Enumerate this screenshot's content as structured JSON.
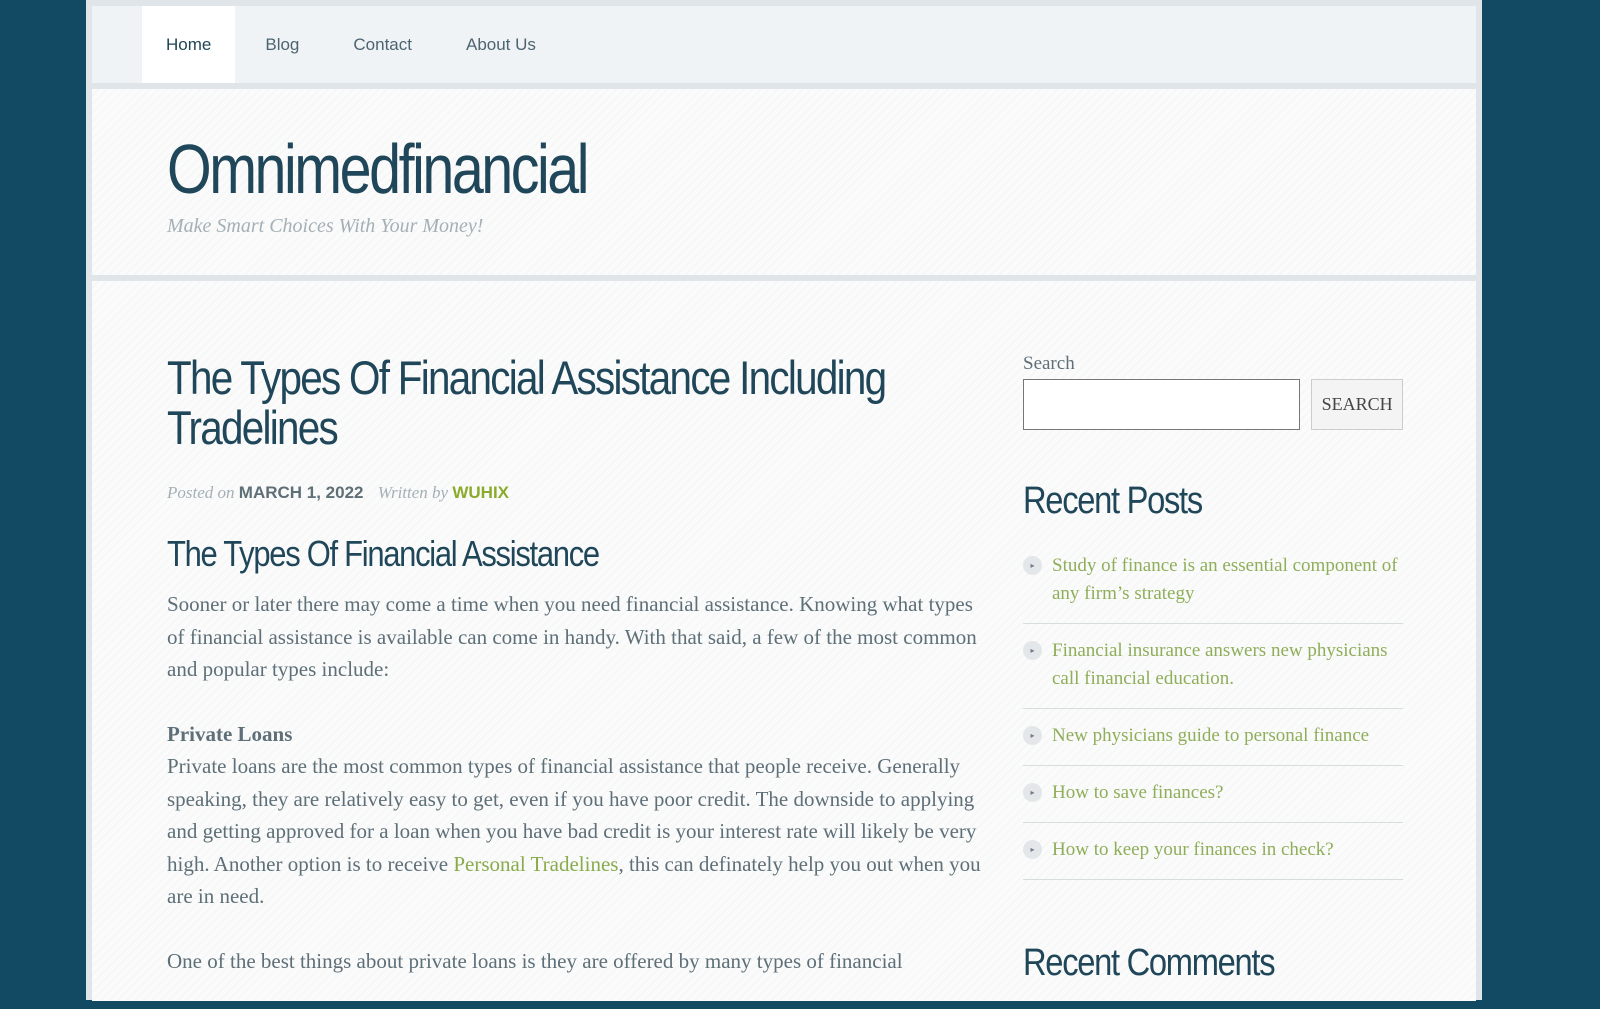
{
  "nav": {
    "items": [
      {
        "label": "Home"
      },
      {
        "label": "Blog"
      },
      {
        "label": "Contact"
      },
      {
        "label": "About Us"
      }
    ]
  },
  "header": {
    "title": "Omnimedfinancial",
    "tagline": "Make Smart Choices With Your Money!"
  },
  "post": {
    "title": "The Types Of Financial Assistance Including Tradelines",
    "posted_on": "Posted on",
    "date": "MARCH 1, 2022",
    "written_by": "Written by",
    "author": "WUHIX",
    "heading": "The Types Of Financial Assistance",
    "p1": "Sooner or later there may come a time when you need financial assistance. Knowing what types of financial assistance is available can come in handy. With that said, a few of the most common and popular types include:",
    "sub1": "Private Loans",
    "p2a": "Private loans are the most common types of financial assistance that people receive. Generally speaking, they are relatively easy to get, even if you have poor credit. The downside to applying and getting approved for a loan when you have bad credit is your interest rate will likely be very high. Another option is to receive ",
    "p2link": "Personal Tradelines",
    "p2b": ", this can definately help you out when you are in need.",
    "p3": "One of the best things about private loans is they are offered by many types of financial"
  },
  "sidebar": {
    "search_label": "Search",
    "search_value": "",
    "search_button": "SEARCH",
    "recent_posts_title": "Recent Posts",
    "recent_posts": [
      {
        "label": "Study of finance is an essential component of any firm’s strategy"
      },
      {
        "label": "Financial insurance answers new physicians call financial education."
      },
      {
        "label": "New physicians guide to personal finance"
      },
      {
        "label": "How to save finances?"
      },
      {
        "label": "How to keep your finances in check?"
      }
    ],
    "recent_comments_title": "Recent Comments"
  },
  "colors": {
    "background": "#134a63",
    "accent": "#8aab2c",
    "heading": "#204659"
  }
}
